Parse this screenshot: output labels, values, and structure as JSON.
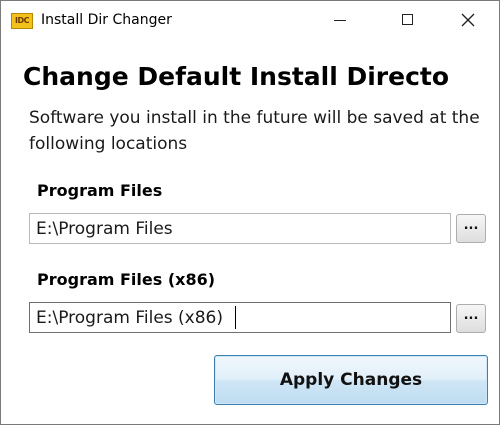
{
  "window": {
    "title": "Install Dir Changer",
    "icon_text": "IDC",
    "icon_name": "app-icon",
    "controls": {
      "minimize_icon": "minimize-icon",
      "maximize_icon": "maximize-icon",
      "close_icon": "close-icon"
    }
  },
  "main": {
    "heading": "Change Default Install Directo",
    "subtitle": "Software you install in the future will be saved at the following locations",
    "program_files": {
      "label": "Program Files",
      "value": "E:\\Program Files",
      "browse_label": "..."
    },
    "program_files_x86": {
      "label": "Program Files (x86)",
      "value": "E:\\Program Files (x86)",
      "browse_label": "..."
    },
    "apply_label": "Apply Changes"
  },
  "colors": {
    "accent_border": "#3c7fb1",
    "app_icon": "#f3c11b"
  }
}
